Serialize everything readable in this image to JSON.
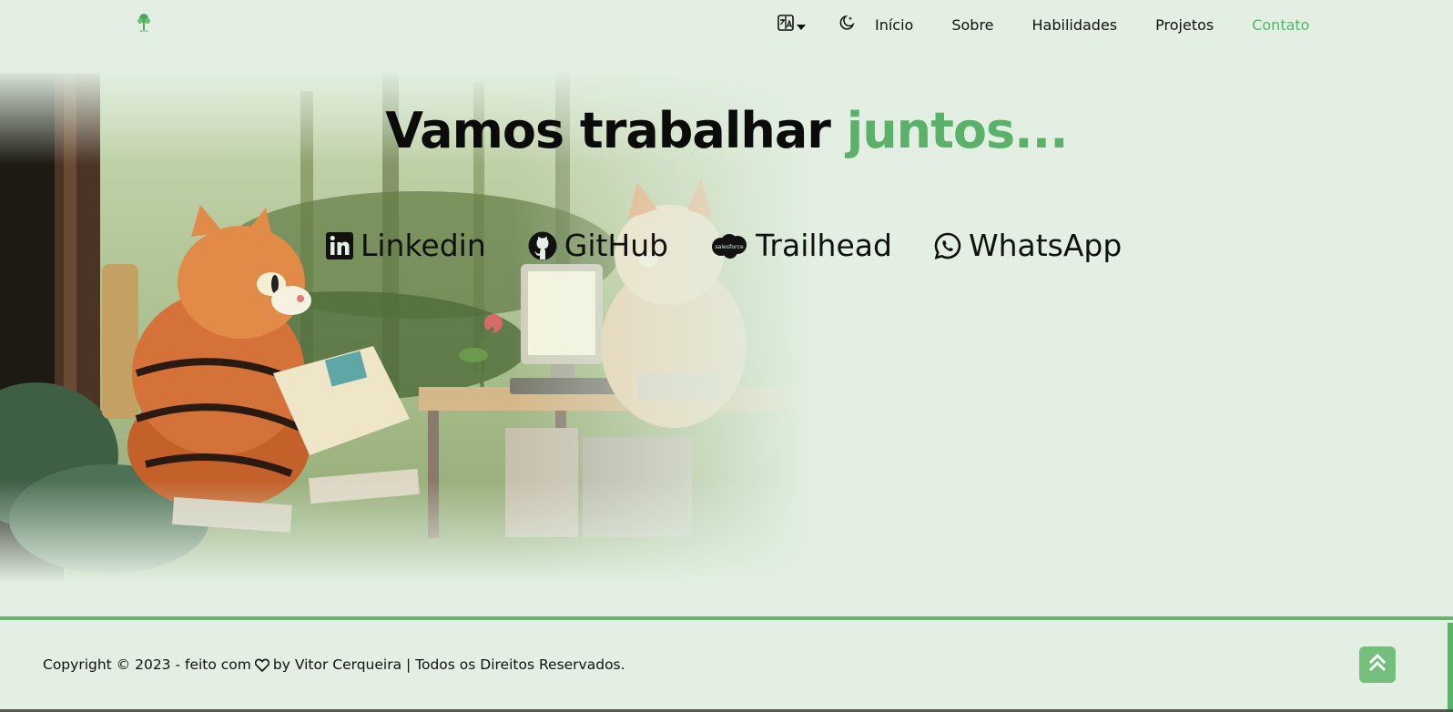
{
  "header": {
    "nav": [
      "Início",
      "Sobre",
      "Habilidades",
      "Projetos",
      "Contato"
    ],
    "active": "Contato"
  },
  "hero": {
    "title_main": "Vamos trabalhar ",
    "title_accent": "juntos...",
    "socials": [
      {
        "label": "Linkedin",
        "icon": "linkedin-icon"
      },
      {
        "label": "GitHub",
        "icon": "github-icon"
      },
      {
        "label": "Trailhead",
        "icon": "salesforce-icon"
      },
      {
        "label": "WhatsApp",
        "icon": "whatsapp-icon"
      }
    ],
    "salesforce_logo_text": "salesforce"
  },
  "footer": {
    "copyright_before": "Copyright © 2023 - feito com",
    "copyright_after": "by Vitor Cerqueira | Todos os Direitos Reservados."
  },
  "colors": {
    "background": "#e2efe2",
    "accent": "#5cb16a",
    "text": "#111111"
  }
}
